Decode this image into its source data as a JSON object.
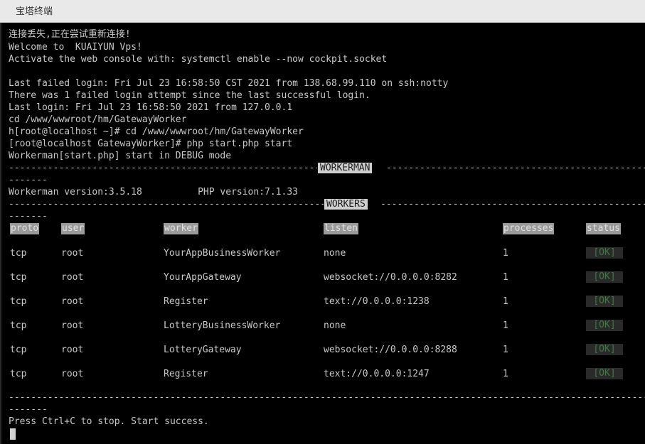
{
  "window": {
    "title": "宝塔终端"
  },
  "terminal": {
    "lines": [
      "连接丢失,正在尝试重新连接!",
      "Welcome to  KUAIYUN Vps!",
      "Activate the web console with: systemctl enable --now cockpit.socket",
      "",
      "Last failed login: Fri Jul 23 16:58:50 CST 2021 from 138.68.99.110 on ssh:notty",
      "There was 1 failed login attempt since the last successful login.",
      "Last login: Fri Jul 23 16:58:50 2021 from 127.0.0.1",
      "cd /www/wwwroot/hm/GatewayWorker",
      "h[root@localhost ~]# cd /www/wwwroot/hm/GatewayWorker",
      "[root@localhost GatewayWorker]# php start.php start",
      "Workerman[start.php] start in DEBUG mode"
    ],
    "workerman_header": "WORKERMAN",
    "version_line": "Workerman version:3.5.18          PHP version:7.1.33",
    "workers_header": "WORKERS",
    "wrap_dashes": "-------",
    "columns": [
      "proto",
      "user",
      "worker",
      "listen",
      "processes",
      "status"
    ],
    "rows": [
      {
        "proto": "tcp",
        "user": "root",
        "worker": "YourAppBusinessWorker",
        "listen": "none",
        "processes": "1",
        "status": "[OK]"
      },
      {
        "proto": "tcp",
        "user": "root",
        "worker": "YourAppGateway",
        "listen": "websocket://0.0.0.0:8282",
        "processes": "1",
        "status": "[OK]"
      },
      {
        "proto": "tcp",
        "user": "root",
        "worker": "Register",
        "listen": "text://0.0.0.0:1238",
        "processes": "1",
        "status": "[OK]"
      },
      {
        "proto": "tcp",
        "user": "root",
        "worker": "LotteryBusinessWorker",
        "listen": "none",
        "processes": "1",
        "status": "[OK]"
      },
      {
        "proto": "tcp",
        "user": "root",
        "worker": "LotteryGateway",
        "listen": "websocket://0.0.0.0:8288",
        "processes": "1",
        "status": "[OK]"
      },
      {
        "proto": "tcp",
        "user": "root",
        "worker": "Register",
        "listen": "text://0.0.0.0:1247",
        "processes": "1",
        "status": "[OK]"
      }
    ],
    "footer": "Press Ctrl+C to stop. Start success."
  },
  "colors": {
    "background": "#000000",
    "text": "#c8c8c8",
    "ok_text": "#3e7a3e",
    "titlebar": "#e9e9e9"
  }
}
